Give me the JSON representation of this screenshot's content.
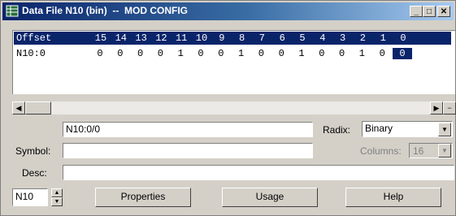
{
  "window": {
    "title": "Data File N10 (bin)  --  MOD CONFIG",
    "minimize": "_",
    "maximize": "□",
    "close": "✕"
  },
  "grid": {
    "offset_header": "Offset",
    "bit_headers": [
      "15",
      "14",
      "13",
      "12",
      "11",
      "10",
      "9",
      "8",
      "7",
      "6",
      "5",
      "4",
      "3",
      "2",
      "1",
      "0"
    ],
    "rows": [
      {
        "offset": "N10:0",
        "bits": [
          "0",
          "0",
          "0",
          "0",
          "1",
          "0",
          "0",
          "1",
          "0",
          "0",
          "1",
          "0",
          "0",
          "1",
          "0",
          "0"
        ],
        "selected_bit_index": 15
      }
    ]
  },
  "hscroll": {
    "left_arrow": "◀",
    "right_arrow": "▶",
    "split": "−"
  },
  "address_field": {
    "value": "N10:0/0"
  },
  "radix": {
    "label": "Radix:",
    "value": "Binary"
  },
  "symbol": {
    "label": "Symbol:",
    "value": ""
  },
  "columns": {
    "label": "Columns:",
    "value": "16"
  },
  "desc": {
    "label": "Desc:",
    "value": ""
  },
  "file_selector": {
    "value": "N10"
  },
  "buttons": {
    "properties": "Properties",
    "usage": "Usage",
    "help": "Help"
  },
  "colors": {
    "title_start": "#0a246a",
    "title_end": "#a6caf0",
    "header_bg": "#0a246a",
    "face": "#d4d0c8"
  }
}
